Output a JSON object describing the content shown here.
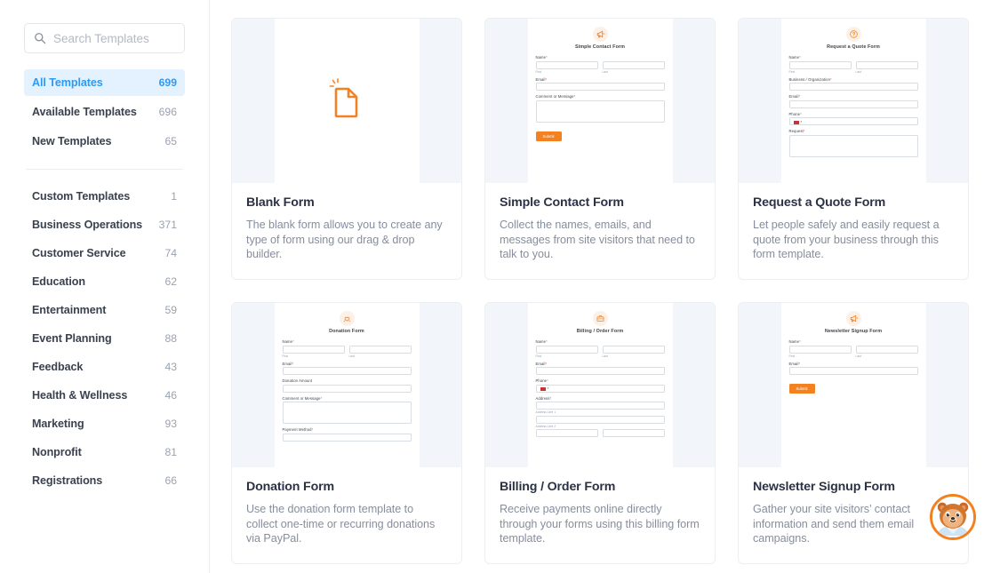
{
  "sidebar": {
    "search": {
      "placeholder": "Search Templates",
      "value": "",
      "icon": "search-icon"
    },
    "nav": [
      {
        "label": "All Templates",
        "count": "699",
        "active": true
      },
      {
        "label": "Available Templates",
        "count": "696",
        "active": false
      },
      {
        "label": "New Templates",
        "count": "65",
        "active": false
      }
    ],
    "categories": [
      {
        "label": "Custom Templates",
        "count": "1"
      },
      {
        "label": "Business Operations",
        "count": "371"
      },
      {
        "label": "Customer Service",
        "count": "74"
      },
      {
        "label": "Education",
        "count": "62"
      },
      {
        "label": "Entertainment",
        "count": "59"
      },
      {
        "label": "Event Planning",
        "count": "88"
      },
      {
        "label": "Feedback",
        "count": "43"
      },
      {
        "label": "Health & Wellness",
        "count": "46"
      },
      {
        "label": "Marketing",
        "count": "93"
      },
      {
        "label": "Nonprofit",
        "count": "81"
      },
      {
        "label": "Registrations",
        "count": "66"
      }
    ]
  },
  "cards": [
    {
      "title": "Blank Form",
      "description": "The blank form allows you to create any type of form using our drag & drop builder.",
      "preview_kind": "blank",
      "preview_icon": "blank-document-icon"
    },
    {
      "title": "Simple Contact Form",
      "description": "Collect the names, emails, and messages from site visitors that need to talk to you.",
      "preview_kind": "form",
      "preview_icon": "megaphone-icon",
      "form_title": "Simple Contact Form",
      "submit_label": "Submit"
    },
    {
      "title": "Request a Quote Form",
      "description": "Let people safely and easily request a quote from your business through this form template.",
      "preview_kind": "form",
      "preview_icon": "question-mark-icon",
      "form_title": "Request a Quote Form"
    },
    {
      "title": "Donation Form",
      "description": "Use the donation form template to collect one-time or recurring donations via PayPal.",
      "preview_kind": "form",
      "preview_icon": "charity-hands-icon",
      "form_title": "Donation Form"
    },
    {
      "title": "Billing / Order Form",
      "description": "Receive payments online directly through your forms using this billing form template.",
      "preview_kind": "form",
      "preview_icon": "briefcase-icon",
      "form_title": "Billing / Order Form"
    },
    {
      "title": "Newsletter Signup Form",
      "description": "Gather your site visitors’ contact information and send them email campaigns.",
      "preview_kind": "form",
      "preview_icon": "megaphone-icon",
      "form_title": "Newsletter Signup Form",
      "submit_label": "Submit"
    }
  ],
  "form_fields": {
    "name": "Name",
    "first": "First",
    "last": "Last",
    "email": "Email",
    "comment": "Comment or Message",
    "business": "Business / Organization",
    "phone": "Phone",
    "request": "Request",
    "donation_amount": "Donation Amount",
    "payment_method": "Payment Method",
    "address": "Address",
    "address_line_1": "Address Line 1",
    "address_line_2": "Address Line 2",
    "required_mark": "*"
  },
  "chat": {
    "name": "support-chat-avatar"
  },
  "colors": {
    "accent_orange": "#f4811f",
    "accent_blue": "#2a9bf7",
    "active_bg": "#e4f1fe",
    "preview_bg": "#f2f6fb",
    "text_dark": "#2b3245",
    "text_muted": "#868e9d"
  }
}
